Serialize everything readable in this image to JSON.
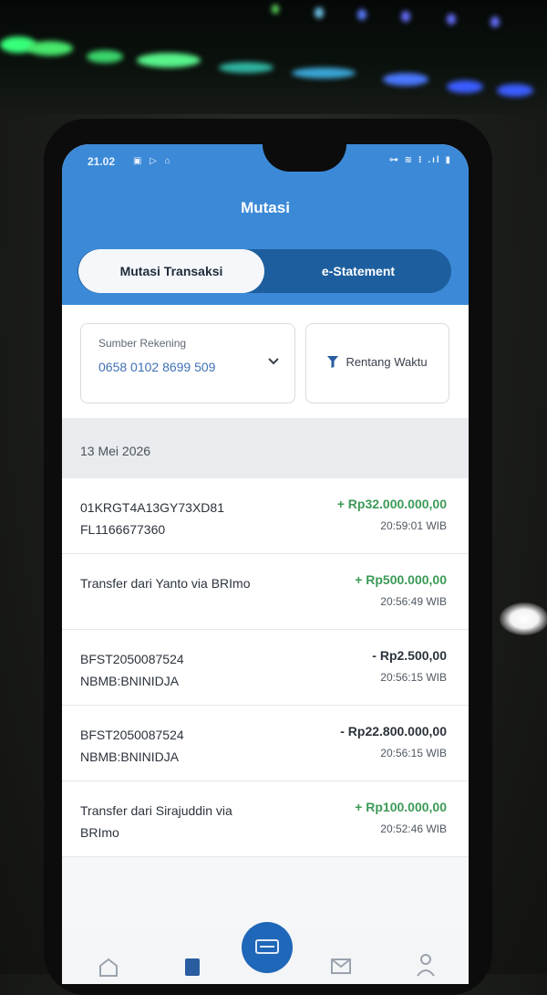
{
  "status_bar": {
    "time": "21.02",
    "left_icons": "▣ ▷ ⌂",
    "right_icons": "⊶ ≋ ⁝ .ıl ▮"
  },
  "header": {
    "title": "Mutasi"
  },
  "tabs": [
    {
      "label": "Mutasi Transaksi",
      "active": true
    },
    {
      "label": "e-Statement",
      "active": false
    }
  ],
  "filters": {
    "source_label": "Sumber Rekening",
    "source_value": "0658 0102 8699 509",
    "range_label": "Rentang Waktu"
  },
  "date_group": "13 Mei 2026",
  "transactions": [
    {
      "description": "01KRGT4A13GY73XD81 FL1166677360",
      "amount": "+ Rp32.000.000,00",
      "time": "20:59:01 WIB",
      "type": "in"
    },
    {
      "description": "Transfer dari Yanto via BRImo",
      "amount": "+ Rp500.000,00",
      "time": "20:56:49 WIB",
      "type": "in"
    },
    {
      "description": "BFST2050087524 NBMB:BNINIDJA",
      "amount": "- Rp2.500,00",
      "time": "20:56:15 WIB",
      "type": "out"
    },
    {
      "description": "BFST2050087524 NBMB:BNINIDJA",
      "amount": "- Rp22.800.000,00",
      "time": "20:56:15 WIB",
      "type": "out"
    },
    {
      "description": "Transfer dari Sirajuddin via BRImo",
      "amount": "+ Rp100.000,00",
      "time": "20:52:46 WIB",
      "type": "in"
    }
  ],
  "colors": {
    "header": "#3c8ad7",
    "tab_track": "#1d5f9e",
    "incoming": "#3c9a57",
    "outgoing": "#2c333c",
    "account_value": "#3f72b5"
  },
  "icons": {
    "dropdown": "chevron-down-icon",
    "filter": "filter-icon",
    "nav": [
      "home-icon",
      "mutasi-icon",
      "qris-icon",
      "mail-icon",
      "person-icon"
    ]
  }
}
